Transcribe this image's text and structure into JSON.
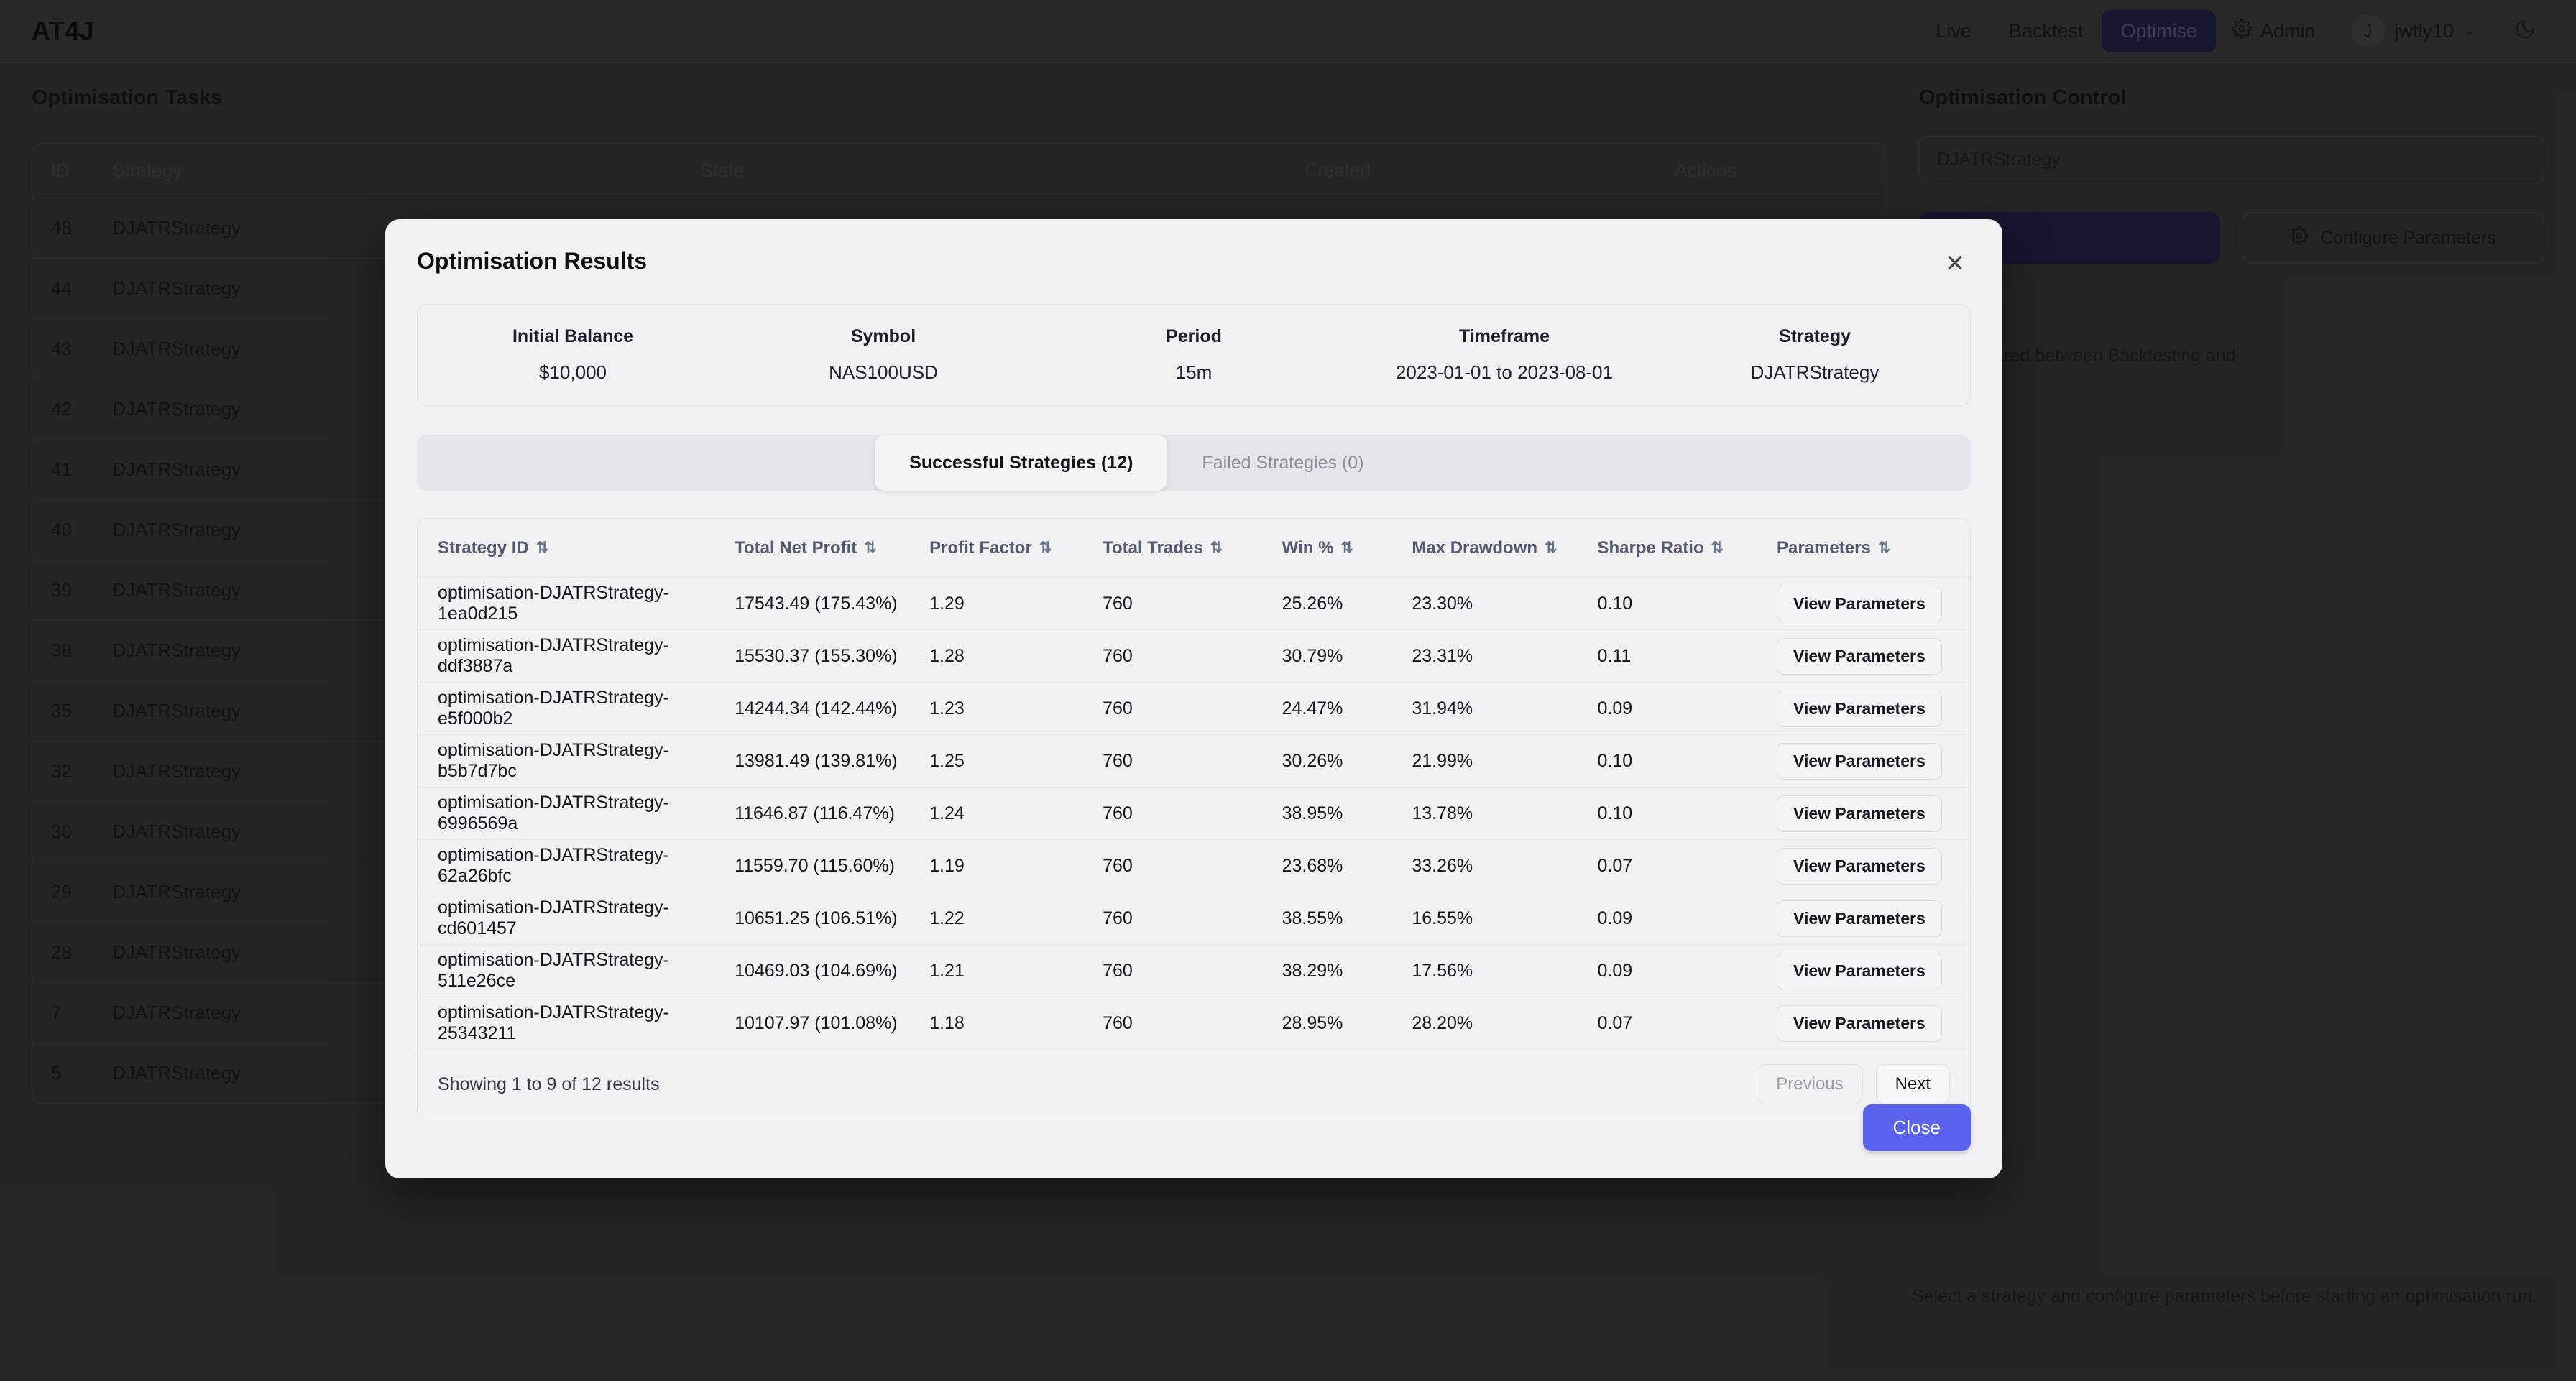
{
  "topnav": {
    "brand": "AT4J",
    "links": [
      {
        "label": "Live",
        "active": false
      },
      {
        "label": "Backtest",
        "active": false
      },
      {
        "label": "Optimise",
        "active": true
      }
    ],
    "admin_label": "Admin",
    "admin_icon": "gear-icon",
    "user": {
      "initial": "J",
      "name": "jwtly10",
      "chevron": "⌄"
    },
    "theme_icon": "moon-icon"
  },
  "background": {
    "section_title": "Optimisation Tasks",
    "table": {
      "columns": [
        "ID",
        "Strategy",
        "State",
        "Created",
        "Actions"
      ],
      "rows": [
        {
          "id": "48",
          "strategy": "DJATRStrategy"
        },
        {
          "id": "44",
          "strategy": "DJATRStrategy"
        },
        {
          "id": "43",
          "strategy": "DJATRStrategy"
        },
        {
          "id": "42",
          "strategy": "DJATRStrategy"
        },
        {
          "id": "41",
          "strategy": "DJATRStrategy"
        },
        {
          "id": "40",
          "strategy": "DJATRStrategy"
        },
        {
          "id": "39",
          "strategy": "DJATRStrategy"
        },
        {
          "id": "38",
          "strategy": "DJATRStrategy"
        },
        {
          "id": "35",
          "strategy": "DJATRStrategy"
        },
        {
          "id": "32",
          "strategy": "DJATRStrategy"
        },
        {
          "id": "30",
          "strategy": "DJATRStrategy"
        },
        {
          "id": "29",
          "strategy": "DJATRStrategy"
        },
        {
          "id": "28",
          "strategy": "DJATRStrategy"
        },
        {
          "id": "7",
          "strategy": "DJATRStrategy"
        },
        {
          "id": "5",
          "strategy": "DJATRStrategy"
        }
      ]
    }
  },
  "control_panel": {
    "title": "Optimisation Control",
    "strategy_value": "DJATRStrategy",
    "configure_label": "Configure Parameters",
    "configure_icon": "gear-icon",
    "note": "on are shared between Backtesting and",
    "footer_note": "Select a strategy and configure parameters before starting an optimisation run."
  },
  "modal": {
    "title": "Optimisation Results",
    "close_icon": "close-icon",
    "summary": [
      {
        "label": "Initial Balance",
        "value": "$10,000"
      },
      {
        "label": "Symbol",
        "value": "NAS100USD"
      },
      {
        "label": "Period",
        "value": "15m"
      },
      {
        "label": "Timeframe",
        "value": "2023-01-01 to 2023-08-01"
      },
      {
        "label": "Strategy",
        "value": "DJATRStrategy"
      }
    ],
    "tabs": [
      {
        "label": "Successful Strategies (12)",
        "active": true
      },
      {
        "label": "Failed Strategies (0)",
        "active": false
      }
    ],
    "table": {
      "columns": [
        "Strategy ID",
        "Total Net Profit",
        "Profit Factor",
        "Total Trades",
        "Win %",
        "Max Drawdown",
        "Sharpe Ratio",
        "Parameters"
      ],
      "sort_icon": "⇅",
      "view_params_label": "View Parameters",
      "rows": [
        {
          "strategy_id": "optimisation-DJATRStrategy-1ea0d215",
          "total_net_profit": "17543.49 (175.43%)",
          "profit_factor": "1.29",
          "total_trades": "760",
          "win_pct": "25.26%",
          "max_drawdown": "23.30%",
          "sharpe_ratio": "0.10"
        },
        {
          "strategy_id": "optimisation-DJATRStrategy-ddf3887a",
          "total_net_profit": "15530.37 (155.30%)",
          "profit_factor": "1.28",
          "total_trades": "760",
          "win_pct": "30.79%",
          "max_drawdown": "23.31%",
          "sharpe_ratio": "0.11"
        },
        {
          "strategy_id": "optimisation-DJATRStrategy-e5f000b2",
          "total_net_profit": "14244.34 (142.44%)",
          "profit_factor": "1.23",
          "total_trades": "760",
          "win_pct": "24.47%",
          "max_drawdown": "31.94%",
          "sharpe_ratio": "0.09"
        },
        {
          "strategy_id": "optimisation-DJATRStrategy-b5b7d7bc",
          "total_net_profit": "13981.49 (139.81%)",
          "profit_factor": "1.25",
          "total_trades": "760",
          "win_pct": "30.26%",
          "max_drawdown": "21.99%",
          "sharpe_ratio": "0.10"
        },
        {
          "strategy_id": "optimisation-DJATRStrategy-6996569a",
          "total_net_profit": "11646.87 (116.47%)",
          "profit_factor": "1.24",
          "total_trades": "760",
          "win_pct": "38.95%",
          "max_drawdown": "13.78%",
          "sharpe_ratio": "0.10"
        },
        {
          "strategy_id": "optimisation-DJATRStrategy-62a26bfc",
          "total_net_profit": "11559.70 (115.60%)",
          "profit_factor": "1.19",
          "total_trades": "760",
          "win_pct": "23.68%",
          "max_drawdown": "33.26%",
          "sharpe_ratio": "0.07"
        },
        {
          "strategy_id": "optimisation-DJATRStrategy-cd601457",
          "total_net_profit": "10651.25 (106.51%)",
          "profit_factor": "1.22",
          "total_trades": "760",
          "win_pct": "38.55%",
          "max_drawdown": "16.55%",
          "sharpe_ratio": "0.09"
        },
        {
          "strategy_id": "optimisation-DJATRStrategy-511e26ce",
          "total_net_profit": "10469.03 (104.69%)",
          "profit_factor": "1.21",
          "total_trades": "760",
          "win_pct": "38.29%",
          "max_drawdown": "17.56%",
          "sharpe_ratio": "0.09"
        },
        {
          "strategy_id": "optimisation-DJATRStrategy-25343211",
          "total_net_profit": "10107.97 (101.08%)",
          "profit_factor": "1.18",
          "total_trades": "760",
          "win_pct": "28.95%",
          "max_drawdown": "28.20%",
          "sharpe_ratio": "0.07"
        }
      ]
    },
    "pagination": {
      "summary": "Showing 1 to 9 of 12 results",
      "previous_label": "Previous",
      "next_label": "Next"
    },
    "close_button_label": "Close"
  },
  "colors": {
    "accent": "#5a62ee",
    "nav_active_bg": "#1b1b3c",
    "modal_bg": "#f1f1f4",
    "page_bg": "#2e2e2e"
  }
}
